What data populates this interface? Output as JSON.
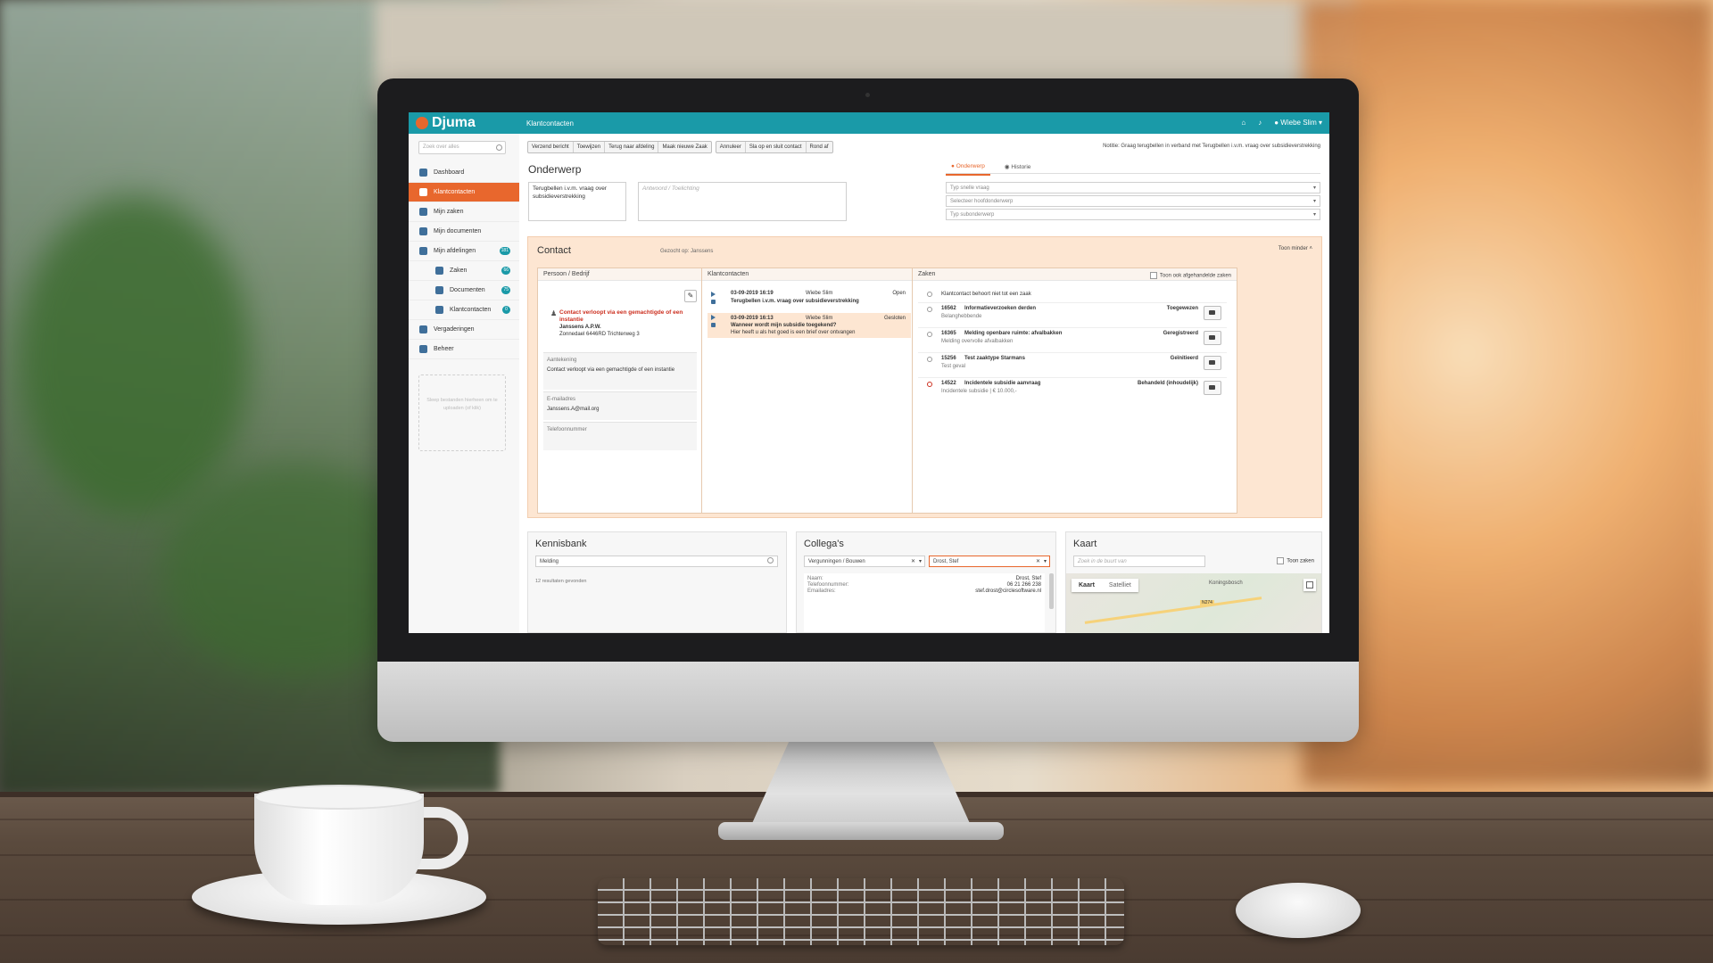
{
  "app": {
    "logo": "Djuma",
    "page_title": "Klantcontacten",
    "user": "Wiebe Slim"
  },
  "sidebar": {
    "search_placeholder": "Zoek over alles",
    "items": [
      {
        "label": "Dashboard"
      },
      {
        "label": "Klantcontacten"
      },
      {
        "label": "Mijn zaken"
      },
      {
        "label": "Mijn documenten"
      },
      {
        "label": "Mijn afdelingen",
        "badge": "181"
      },
      {
        "label": "Zaken",
        "badge": "66"
      },
      {
        "label": "Documenten",
        "badge": "75"
      },
      {
        "label": "Klantcontacten",
        "badge": "0"
      },
      {
        "label": "Vergaderingen"
      },
      {
        "label": "Beheer"
      }
    ],
    "drop_text": "Sleep bestanden hierheen om te uploaden (of klik)"
  },
  "toolbar": {
    "group1": [
      "Verzend bericht",
      "Toewijzen",
      "Terug naar afdeling",
      "Maak nieuwe Zaak"
    ],
    "group2": [
      "Annuleer",
      "Sla op en sluit contact",
      "Rond af"
    ]
  },
  "notice": "Notitie: Graag terugbellen in verband met Terugbellen i.v.m. vraag over subsidieverstrekking",
  "onderwerp": {
    "heading": "Onderwerp",
    "tabs": [
      "Onderwerp",
      "Historie"
    ],
    "question_text": "Terugbellen i.v.m. vraag over subsidieverstrekking",
    "answer_placeholder": "Antwoord / Toelichting",
    "selects": [
      "Typ snelle vraag",
      "Selecteer hoofdonderwerp",
      "Typ subonderwerp"
    ]
  },
  "contact": {
    "title": "Contact",
    "searched": "Gezocht op: Janssens",
    "toggle": "Toon minder",
    "person_card": {
      "title": "Persoon / Bedrijf",
      "warning": "Contact verloopt via een gemachtigde of een instantie",
      "name": "Janssens A.P.W.",
      "address": "Zonnedael 6446RD Trichterweg 3",
      "note_label": "Aantekening",
      "note_value": "Contact verloopt via een gemachtigde of een instantie",
      "email_label": "E-mailadres",
      "email_value": "Janssens.A@mail.org",
      "phone_label": "Telefoonnummer"
    },
    "kc_card": {
      "title": "Klantcontacten",
      "rows": [
        {
          "date": "03-09-2019 16:19",
          "user": "Wiebe Slim",
          "status": "Open",
          "subject": "Terugbellen i.v.m. vraag over subsidieverstrekking",
          "detail": ""
        },
        {
          "date": "03-09-2019 16:13",
          "user": "Wiebe Slim",
          "status": "Gesloten",
          "subject": "Wanneer wordt mijn subsidie toegekend?",
          "detail": "Hier heeft u als het goed is een brief over ontvangen"
        }
      ]
    },
    "zaken_card": {
      "title": "Zaken",
      "toggle": "Toon ook afgehandelde zaken",
      "none_label": "Klantcontact behoort niet tot een zaak",
      "rows": [
        {
          "id": "16562",
          "name": "Informatieverzoeken derden",
          "status": "Toegewezen",
          "sub": "Belanghebbende"
        },
        {
          "id": "16365",
          "name": "Melding openbare ruimte: afvalbakken",
          "status": "Geregistreerd",
          "sub": "Melding overvolle afvalbakken"
        },
        {
          "id": "15256",
          "name": "Test zaaktype Starmans",
          "status": "Geïnitieerd",
          "sub": "Test geval"
        },
        {
          "id": "14522",
          "name": "Incidentele subsidie aanvraag",
          "status": "Behandeld (inhoudelijk)",
          "sub": "Incidentele subsidie | € 10.000,-"
        }
      ]
    }
  },
  "kennisbank": {
    "title": "Kennisbank",
    "query": "Melding",
    "results": "12 resultaten gevonden"
  },
  "collegas": {
    "title": "Collega's",
    "dept": "Vergunningen / Bouwen",
    "person": "Drost, Stef",
    "labels": [
      "Naam:",
      "Telefoonnummer:",
      "Emailadres:"
    ],
    "values": [
      "Drost, Stef",
      "06 21 266 238",
      "stef.drost@circlesoftware.nl"
    ]
  },
  "kaart": {
    "title": "Kaart",
    "placeholder": "Zoek in de buurt van",
    "toggle": "Toon zaken",
    "map_buttons": [
      "Kaart",
      "Satelliet"
    ],
    "place": "Koningsbosch",
    "road": "N274"
  }
}
